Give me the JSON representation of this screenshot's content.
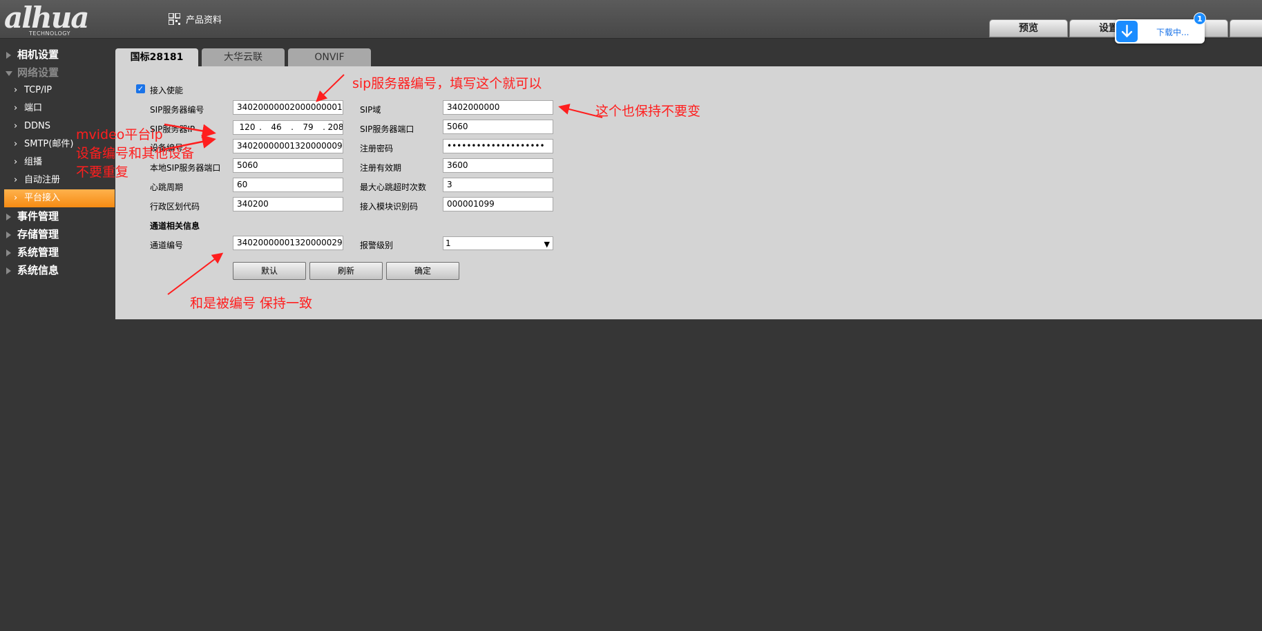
{
  "header": {
    "logo_text": "alhua",
    "logo_sub": "TECHNOLOGY",
    "product_info": "产品资料",
    "tabs": [
      {
        "label": "预览"
      },
      {
        "label": "设置"
      },
      {
        "label": ""
      }
    ],
    "download": {
      "label": "下载中...",
      "badge": "1"
    }
  },
  "sidebar": {
    "items": [
      {
        "label": "相机设置"
      },
      {
        "label": "网络设置"
      },
      {
        "label": "TCP/IP"
      },
      {
        "label": "端口"
      },
      {
        "label": "DDNS"
      },
      {
        "label": "SMTP(邮件)"
      },
      {
        "label": "组播"
      },
      {
        "label": "自动注册"
      },
      {
        "label": "平台接入"
      },
      {
        "label": "事件管理"
      },
      {
        "label": "存储管理"
      },
      {
        "label": "系统管理"
      },
      {
        "label": "系统信息"
      }
    ]
  },
  "content": {
    "tabs": [
      {
        "label": "国标28181"
      },
      {
        "label": "大华云联"
      },
      {
        "label": "ONVIF"
      }
    ],
    "enable_label": "接入使能",
    "enable_checked": true,
    "form": {
      "sip_server_id": {
        "label": "SIP服务器编号",
        "value": "34020000002000000001"
      },
      "sip_domain": {
        "label": "SIP域",
        "value": "3402000000"
      },
      "sip_server_ip": {
        "label": "SIP服务器IP",
        "octets": [
          "120",
          "46",
          "79",
          "208"
        ]
      },
      "sip_server_port": {
        "label": "SIP服务器端口",
        "value": "5060"
      },
      "device_id": {
        "label": "设备编号",
        "value": "34020000001320000009"
      },
      "register_password": {
        "label": "注册密码",
        "value": "••••••••••••••••••••"
      },
      "local_sip_port": {
        "label": "本地SIP服务器端口",
        "value": "5060"
      },
      "register_validity": {
        "label": "注册有效期",
        "value": "3600"
      },
      "heartbeat_period": {
        "label": "心跳周期",
        "value": "60"
      },
      "max_heartbeat_timeout": {
        "label": "最大心跳超时次数",
        "value": "3"
      },
      "region_code": {
        "label": "行政区划代码",
        "value": "340200"
      },
      "module_id": {
        "label": "接入模块识别码",
        "value": "000001099"
      }
    },
    "channel_section_title": "通道相关信息",
    "channel": {
      "channel_id": {
        "label": "通道编号",
        "value": "34020000001320000029"
      },
      "alarm_level": {
        "label": "报警级别",
        "value": "1"
      }
    },
    "buttons": {
      "default": "默认",
      "refresh": "刷新",
      "ok": "确定"
    }
  },
  "annotations": {
    "sip_server_note": "sip服务器编号，填写这个就可以",
    "keep_note": "这个也保持不要变",
    "mvideo_line1": "mvideo平台ip",
    "mvideo_line2": "设备编号和其他设备",
    "mvideo_line3": "不要重复",
    "channel_note": "和是被编号 保持一致",
    "color": "#ff1e1e"
  }
}
